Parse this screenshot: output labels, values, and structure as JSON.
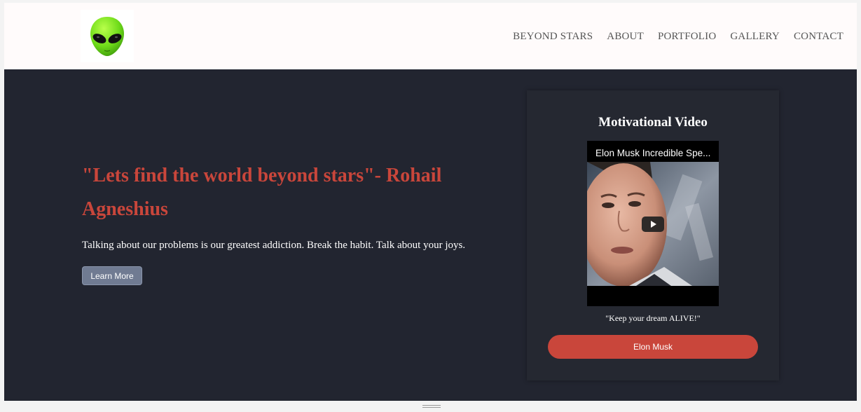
{
  "navbar": {
    "logo_icon": "alien-head-icon",
    "links": [
      "BEYOND STARS",
      "ABOUT",
      "PORTFOLIO",
      "GALLERY",
      "CONTACT"
    ]
  },
  "hero": {
    "headline": "\"Lets find the world beyond stars\"- Rohail Agneshius",
    "tagline": "Talking about our problems is our greatest addiction. Break the habit. Talk about your joys.",
    "button_label": "Learn More"
  },
  "video_card": {
    "title": "Motivational Video",
    "video_title": "Elon Musk Incredible Spe...",
    "play_icon": "play-icon",
    "quote": "\"Keep your dream ALIVE!\"",
    "button_label": "Elon Musk"
  },
  "colors": {
    "navbar_bg": "#fffbfb",
    "hero_bg": "#222530",
    "accent": "#c9463b",
    "learn_button": "#707b92",
    "alien_green": "#7ee62b"
  }
}
